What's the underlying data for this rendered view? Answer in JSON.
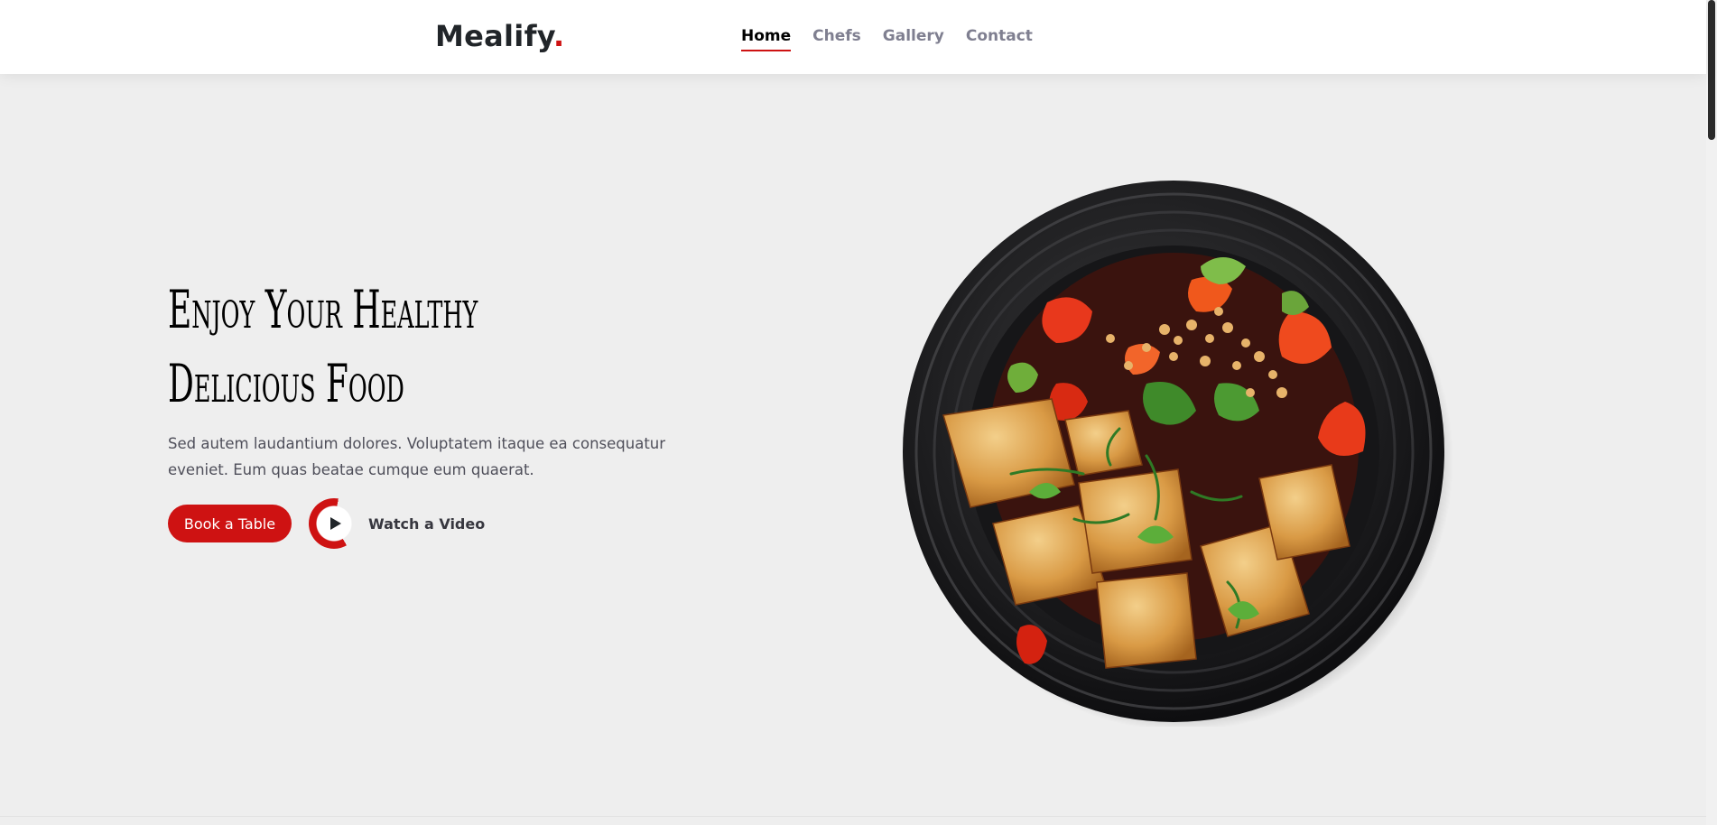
{
  "header": {
    "logo_text": "Mealify",
    "logo_dot": ".",
    "nav": [
      {
        "label": "Home",
        "active": true
      },
      {
        "label": "Chefs",
        "active": false
      },
      {
        "label": "Gallery",
        "active": false
      },
      {
        "label": "Contact",
        "active": false
      }
    ]
  },
  "hero": {
    "title_line1": "Enjoy Your Healthy",
    "title_line2": "Delicious Food",
    "description": "Sed autem laudantium dolores. Voluptatem itaque ea consequatur eveniet. Eum quas beatae cumque eum quaerat.",
    "book_button": "Book a Table",
    "video_button": "Watch a Video",
    "image_subject": "stir-fried tofu with red peppers, peanuts and herbs on a black plate"
  },
  "colors": {
    "accent": "#ce1212",
    "heading": "#000000",
    "body_text": "#4f4f5a",
    "nav_inactive": "#7f7f90",
    "hero_background": "#eeeeee",
    "header_background": "#ffffff"
  },
  "icons": {
    "play": "play-icon"
  }
}
